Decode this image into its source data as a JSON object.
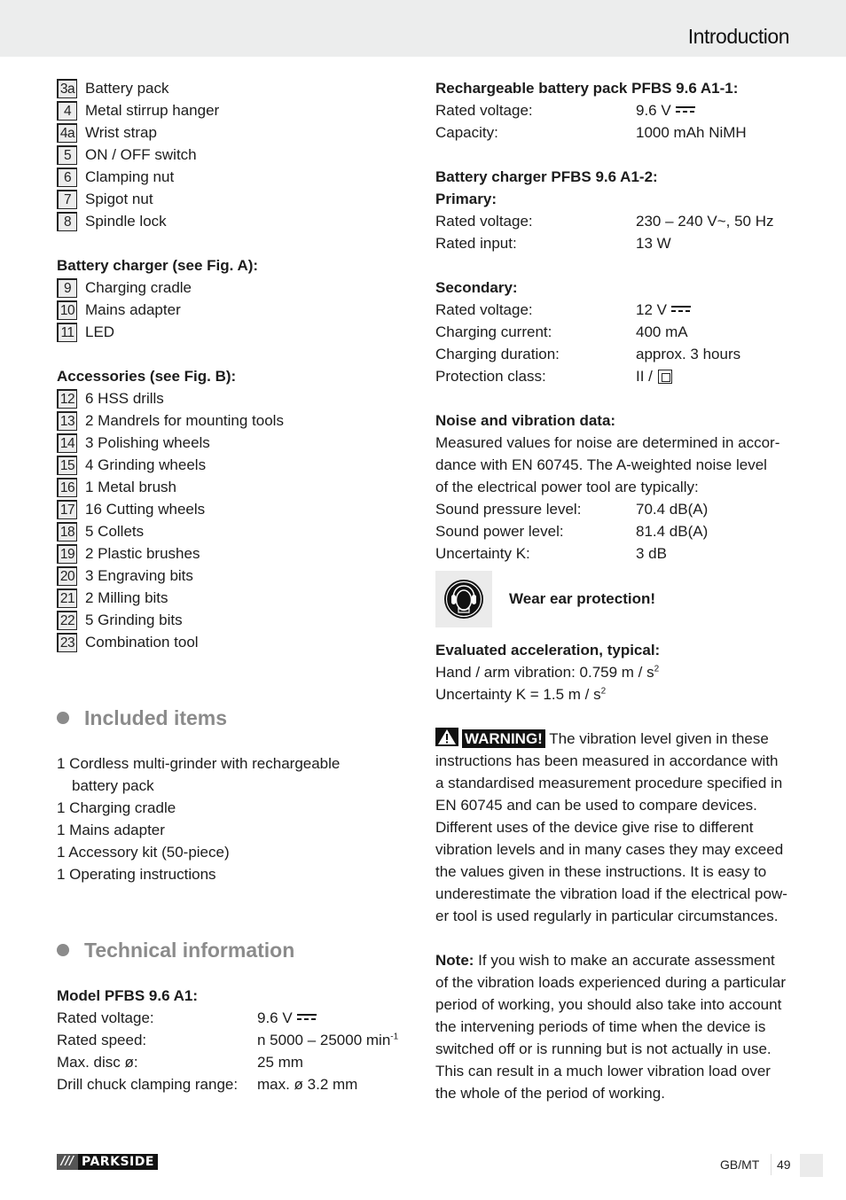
{
  "header": {
    "title": "Introduction"
  },
  "left": {
    "parts": [
      {
        "num": "3a",
        "label": "Battery pack"
      },
      {
        "num": "4",
        "label": "Metal stirrup hanger"
      },
      {
        "num": "4a",
        "label": "Wrist strap"
      },
      {
        "num": "5",
        "label": "ON / OFF switch"
      },
      {
        "num": "6",
        "label": "Clamping nut"
      },
      {
        "num": "7",
        "label": "Spigot nut"
      },
      {
        "num": "8",
        "label": "Spindle lock"
      }
    ],
    "charger_heading": "Battery charger (see Fig. A):",
    "charger_parts": [
      {
        "num": "9",
        "label": "Charging cradle"
      },
      {
        "num": "10",
        "label": "Mains adapter"
      },
      {
        "num": "11",
        "label": "LED"
      }
    ],
    "accessories_heading": "Accessories (see Fig. B):",
    "accessories": [
      {
        "num": "12",
        "label": "6 HSS drills"
      },
      {
        "num": "13",
        "label": "2 Mandrels for mounting tools"
      },
      {
        "num": "14",
        "label": "3 Polishing wheels"
      },
      {
        "num": "15",
        "label": "4 Grinding wheels"
      },
      {
        "num": "16",
        "label": "1 Metal brush"
      },
      {
        "num": "17",
        "label": "16 Cutting wheels"
      },
      {
        "num": "18",
        "label": "5 Collets"
      },
      {
        "num": "19",
        "label": "2 Plastic brushes"
      },
      {
        "num": "20",
        "label": "3 Engraving bits"
      },
      {
        "num": "21",
        "label": "2 Milling bits"
      },
      {
        "num": "22",
        "label": "5 Grinding bits"
      },
      {
        "num": "23",
        "label": "Combination tool"
      }
    ],
    "included": {
      "heading": "Included items",
      "items": [
        "1 Cordless multi-grinder with rechargeable",
        "battery pack",
        "1 Charging cradle",
        "1 Mains adapter",
        "1 Accessory kit (50-piece)",
        "1 Operating instructions"
      ]
    },
    "technical": {
      "heading": "Technical information",
      "model_heading": "Model PFBS 9.6 A1:",
      "rows": [
        {
          "k": "Rated voltage:",
          "v": "9.6 V"
        },
        {
          "k": "Rated speed:",
          "v": "n 5000 – 25000 min",
          "sup": "-1"
        },
        {
          "k": "Max. disc ø:",
          "v": "25 mm"
        },
        {
          "k": "Drill chuck clamping range:",
          "v": "max. ø 3.2 mm"
        }
      ]
    }
  },
  "right": {
    "battery_heading": "Rechargeable battery pack PFBS 9.6 A1-1:",
    "battery_rows": [
      {
        "k": "Rated voltage:",
        "v": "9.6 V"
      },
      {
        "k": "Capacity:",
        "v": "1000 mAh NiMH"
      }
    ],
    "charger_heading": "Battery charger PFBS 9.6 A1-2:",
    "primary_heading": "Primary:",
    "primary_rows": [
      {
        "k": "Rated voltage:",
        "v": "230 – 240 V~, 50 Hz"
      },
      {
        "k": "Rated input:",
        "v": "13 W"
      }
    ],
    "secondary_heading": "Secondary:",
    "secondary_rows": [
      {
        "k": "Rated voltage:",
        "v": "12 V"
      },
      {
        "k": "Charging current:",
        "v": "400 mA"
      },
      {
        "k": "Charging duration:",
        "v": "approx. 3 hours"
      },
      {
        "k": "Protection class:",
        "v": "II / "
      }
    ],
    "noise_heading": "Noise and vibration data:",
    "noise_text": [
      "Measured values for noise are determined in accor-",
      "dance with EN 60745. The A-weighted noise level",
      "of the electrical power tool are typically:"
    ],
    "noise_rows": [
      {
        "k": "Sound pressure level:",
        "v": "70.4 dB(A)"
      },
      {
        "k": "Sound power level:",
        "v": "81.4 dB(A)"
      },
      {
        "k": "Uncertainty K:",
        "v": "3 dB"
      }
    ],
    "ear_protection": "Wear ear protection!",
    "accel_heading": "Evaluated acceleration, typical:",
    "accel_lines": [
      {
        "text": "Hand / arm vibration: 0.759 m / s",
        "sup": "2"
      },
      {
        "text": "Uncertainty K = 1.5 m / s",
        "sup": "2"
      }
    ],
    "warning_label": "WARNING!",
    "warning_lines": [
      " The vibration level given in these",
      "instructions has been measured in accordance with",
      "a standardised measurement procedure specified in",
      "EN 60745 and can be used to compare devices.",
      "Different uses of the device give rise to different",
      "vibration levels and in many cases they may exceed",
      "the values given in these instructions. It is easy to",
      "underestimate the vibration load if the electrical pow-",
      "er tool is used regularly in particular circumstances."
    ],
    "note_label": "Note:",
    "note_lines": [
      " If you wish to make an accurate assessment",
      "of the vibration loads experienced during a particular",
      "period of working, you should also take into account",
      "the intervening periods of time when the device is",
      "switched off or is running but is not actually in use.",
      "This can result in a much lower vibration load over",
      "the whole of the period of working."
    ]
  },
  "footer": {
    "brand_slashes": "///",
    "brand": "PARKSIDE",
    "lang": "GB/MT",
    "page": "49"
  }
}
